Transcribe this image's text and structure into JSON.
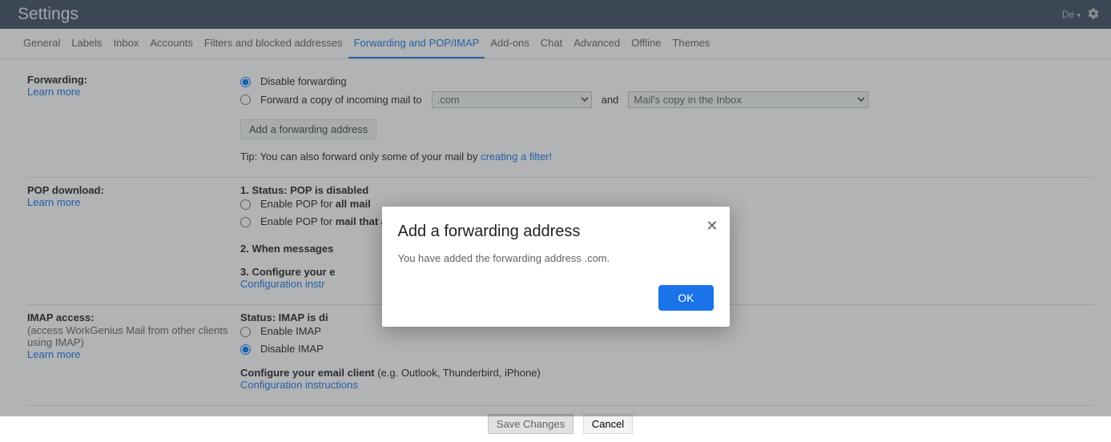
{
  "header": {
    "title": "Settings",
    "lang_label": "De"
  },
  "tabs": [
    {
      "label": "General"
    },
    {
      "label": "Labels"
    },
    {
      "label": "Inbox"
    },
    {
      "label": "Accounts"
    },
    {
      "label": "Filters and blocked addresses"
    },
    {
      "label": "Forwarding and POP/IMAP",
      "active": true
    },
    {
      "label": "Add-ons"
    },
    {
      "label": "Chat"
    },
    {
      "label": "Advanced"
    },
    {
      "label": "Offline"
    },
    {
      "label": "Themes"
    }
  ],
  "forwarding": {
    "title": "Forwarding:",
    "learn_more": "Learn more",
    "disable_label": "Disable forwarding",
    "forward_prefix": "Forward a copy of incoming mail to",
    "forward_email": "                        .com",
    "and_label": "and",
    "action_label": "                        Mail's copy in the Inbox",
    "add_button": "Add a forwarding address",
    "tip_prefix": "Tip: You can also forward only some of your mail by ",
    "tip_link": "creating a filter!"
  },
  "pop": {
    "title": "POP download:",
    "learn_more": "Learn more",
    "status_label": "1. Status: ",
    "status_value": "POP is disabled",
    "enable_all_pre": "Enable POP for ",
    "enable_all_bold": "all mail",
    "enable_now_pre": "Enable POP for ",
    "enable_now_bold": "mail that arrives from now on",
    "when_label": "2. When messages",
    "configure_label": "3. Configure your e",
    "config_link": "Configuration instr"
  },
  "imap": {
    "title": "IMAP access:",
    "sub": "(access WorkGenius Mail from other clients using IMAP)",
    "learn_more": "Learn more",
    "status_label": "Status: ",
    "status_value": "IMAP is di",
    "enable_label": "Enable IMAP",
    "disable_label": "Disable IMAP",
    "configure_bold": "Configure your email client",
    "configure_rest": " (e.g. Outlook, Thunderbird, iPhone)",
    "config_link": "Configuration instructions"
  },
  "actions": {
    "save": "Save Changes",
    "cancel": "Cancel"
  },
  "modal": {
    "title": "Add a forwarding address",
    "body_pre": "You have added the forwarding address ",
    "body_email": "                     .com.",
    "ok": "OK"
  }
}
